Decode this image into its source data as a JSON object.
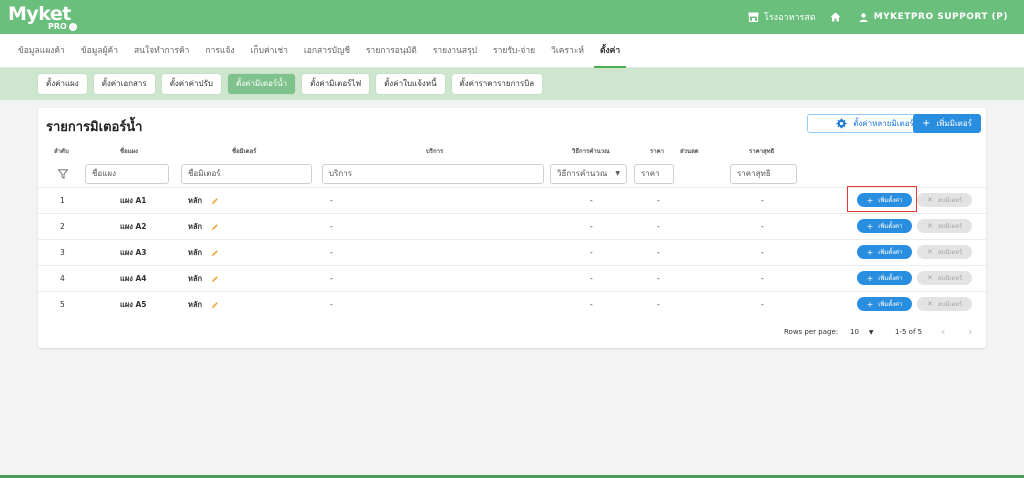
{
  "brand": {
    "name": "Myket",
    "sub": "PRO"
  },
  "header": {
    "store_name": "โรงอาหารสด",
    "user_name": "MYKETPRO SUPPORT (P)"
  },
  "main_nav": [
    {
      "label": "ข้อมูลแผงค้า",
      "active": false
    },
    {
      "label": "ข้อมูลผู้ค้า",
      "active": false
    },
    {
      "label": "สนใจทำการค้า",
      "active": false
    },
    {
      "label": "การแจ้ง",
      "active": false
    },
    {
      "label": "เก็บค่าเช่า",
      "active": false
    },
    {
      "label": "เอกสารบัญชี",
      "active": false
    },
    {
      "label": "รายการอนุมัติ",
      "active": false
    },
    {
      "label": "รายงานสรุป",
      "active": false
    },
    {
      "label": "รายรับ-จ่าย",
      "active": false
    },
    {
      "label": "วิเคราะห์",
      "active": false
    },
    {
      "label": "ตั้งค่า",
      "active": true
    }
  ],
  "sub_nav": [
    {
      "label": "ตั้งค่าแผง",
      "active": false
    },
    {
      "label": "ตั้งค่าเอกสาร",
      "active": false
    },
    {
      "label": "ตั้งค่าค่าปรับ",
      "active": false
    },
    {
      "label": "ตั้งค่ามิเตอร์น้ำ",
      "active": true
    },
    {
      "label": "ตั้งค่ามิเตอร์ไฟ",
      "active": false
    },
    {
      "label": "ตั้งค่าใบแจ้งหนี้",
      "active": false
    },
    {
      "label": "ตั้งค่าราคารายการบิล",
      "active": false
    }
  ],
  "card": {
    "title": "รายการมิเตอร์น้ำ",
    "multi_button": "ตั้งค่าหลายมิเตอร์",
    "add_button": "เพิ่มมิเตอร์"
  },
  "table": {
    "headers": {
      "index": "ลำดับ",
      "stall": "ชื่อแผง",
      "meter": "ชื่อมิเตอร์",
      "service": "บริการ",
      "method": "วิธีการคำนวณ",
      "price": "ราคา",
      "discount": "ส่วนลด",
      "net": "ราคาสุทธิ"
    },
    "filters": {
      "stall": "ชื่อแผง",
      "meter": "ชื่อมิเตอร์",
      "service": "บริการ",
      "method": "วิธีการคำนวณ",
      "price": "ราคา",
      "net": "ราคาสุทธิ"
    },
    "rows": [
      {
        "index": "1",
        "stall": "แผง A1",
        "meter": "หลัก",
        "service": "-",
        "method": "-",
        "price": "-",
        "net": "-"
      },
      {
        "index": "2",
        "stall": "แผง A2",
        "meter": "หลัก",
        "service": "-",
        "method": "-",
        "price": "-",
        "net": "-"
      },
      {
        "index": "3",
        "stall": "แผง A3",
        "meter": "หลัก",
        "service": "-",
        "method": "-",
        "price": "-",
        "net": "-"
      },
      {
        "index": "4",
        "stall": "แผง A4",
        "meter": "หลัก",
        "service": "-",
        "method": "-",
        "price": "-",
        "net": "-"
      },
      {
        "index": "5",
        "stall": "แผง A5",
        "meter": "หลัก",
        "service": "-",
        "method": "-",
        "price": "-",
        "net": "-"
      }
    ],
    "row_actions": {
      "add": "เพิ่มตั้งค่า",
      "delete": "ลบมิเตอร์"
    }
  },
  "pagination": {
    "rows_per_page_label": "Rows per page:",
    "rows_per_page": "10",
    "range": "1-5 of 5"
  },
  "colors": {
    "topbar": "#6bbf7c",
    "subnav": "#cde6cd",
    "primary": "#2a8ee0",
    "highlight": "#e53935"
  }
}
